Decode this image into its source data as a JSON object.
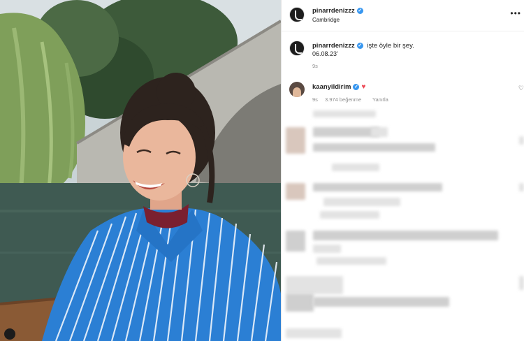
{
  "post": {
    "author": "pinarrdenizzz",
    "location": "Cambridge",
    "more_icon": "more-horizontal-icon"
  },
  "caption": {
    "author": "pinarrdenizzz",
    "text": "işte öyle bir şey.",
    "date": "06.08.23'",
    "time": "9s"
  },
  "comment": {
    "author": "kaanyildirim",
    "time": "9s",
    "likes": "3.974 beğenme",
    "reply": "Yanıtla"
  },
  "colors": {
    "verified": "#3897f0",
    "heart": "#ed4956",
    "shirt": "#2b7fd4",
    "water": "#3f5a52"
  }
}
